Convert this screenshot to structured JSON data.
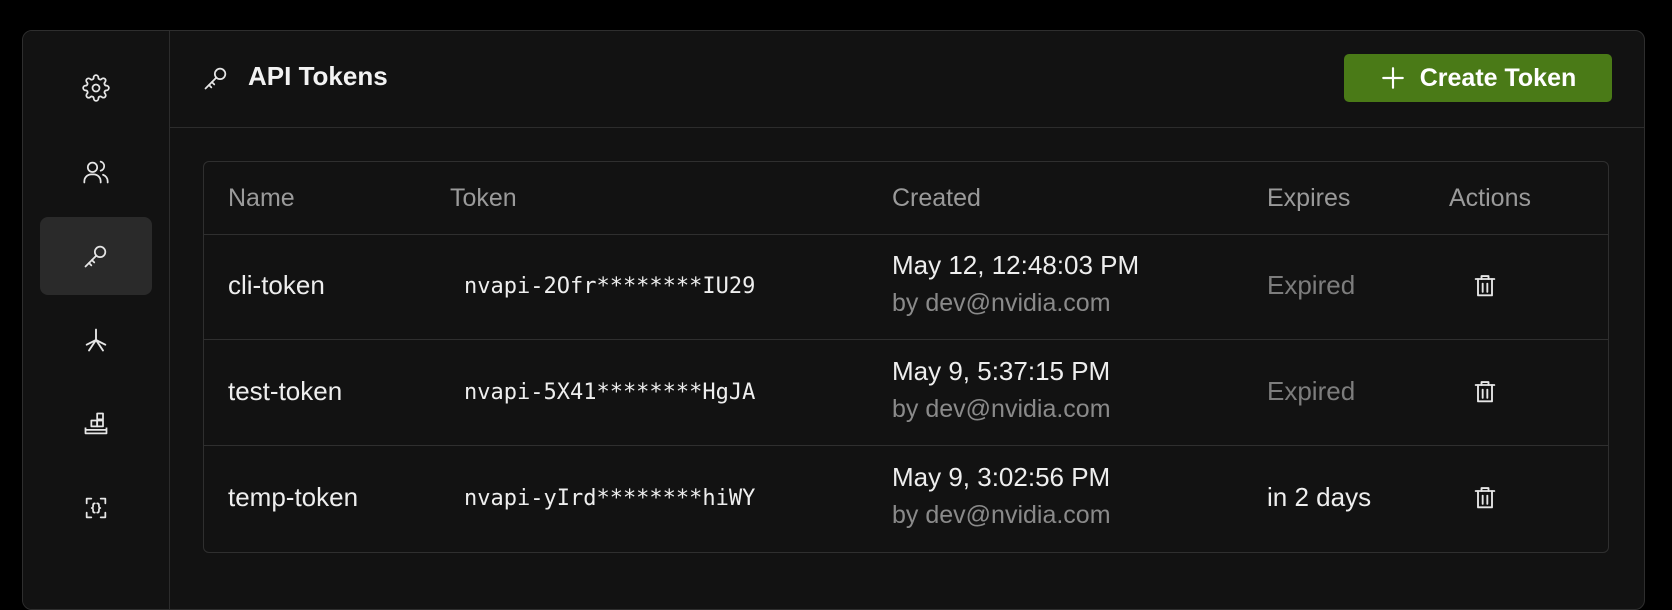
{
  "sidebar": {
    "items": [
      {
        "name": "settings",
        "icon": "gear-icon",
        "active": false
      },
      {
        "name": "users",
        "icon": "users-icon",
        "active": false
      },
      {
        "name": "api-tokens",
        "icon": "key-icon",
        "active": true
      },
      {
        "name": "asterisk",
        "icon": "asterisk-icon",
        "active": false
      },
      {
        "name": "deployments",
        "icon": "blocks-icon",
        "active": false
      },
      {
        "name": "json-schema",
        "icon": "braces-icon",
        "active": false
      }
    ]
  },
  "header": {
    "title": "API Tokens",
    "icon": "key-icon",
    "create_button_label": "Create Token",
    "create_button_icon": "plus-icon",
    "accent": "#4a7a17"
  },
  "table": {
    "columns": [
      "Name",
      "Token",
      "Created",
      "Expires",
      "Actions"
    ],
    "rows": [
      {
        "name": "cli-token",
        "token": "nvapi-2Ofr********IU29",
        "created": "May 12, 12:48:03 PM",
        "created_by": "by dev@nvidia.com",
        "expires": "Expired",
        "expired": true
      },
      {
        "name": "test-token",
        "token": "nvapi-5X41********HgJA",
        "created": "May 9, 5:37:15 PM",
        "created_by": "by dev@nvidia.com",
        "expires": "Expired",
        "expired": true
      },
      {
        "name": "temp-token",
        "token": "nvapi-yIrd********hiWY",
        "created": "May 9, 3:02:56 PM",
        "created_by": "by dev@nvidia.com",
        "expires": "in 2 days",
        "expired": false
      }
    ]
  }
}
